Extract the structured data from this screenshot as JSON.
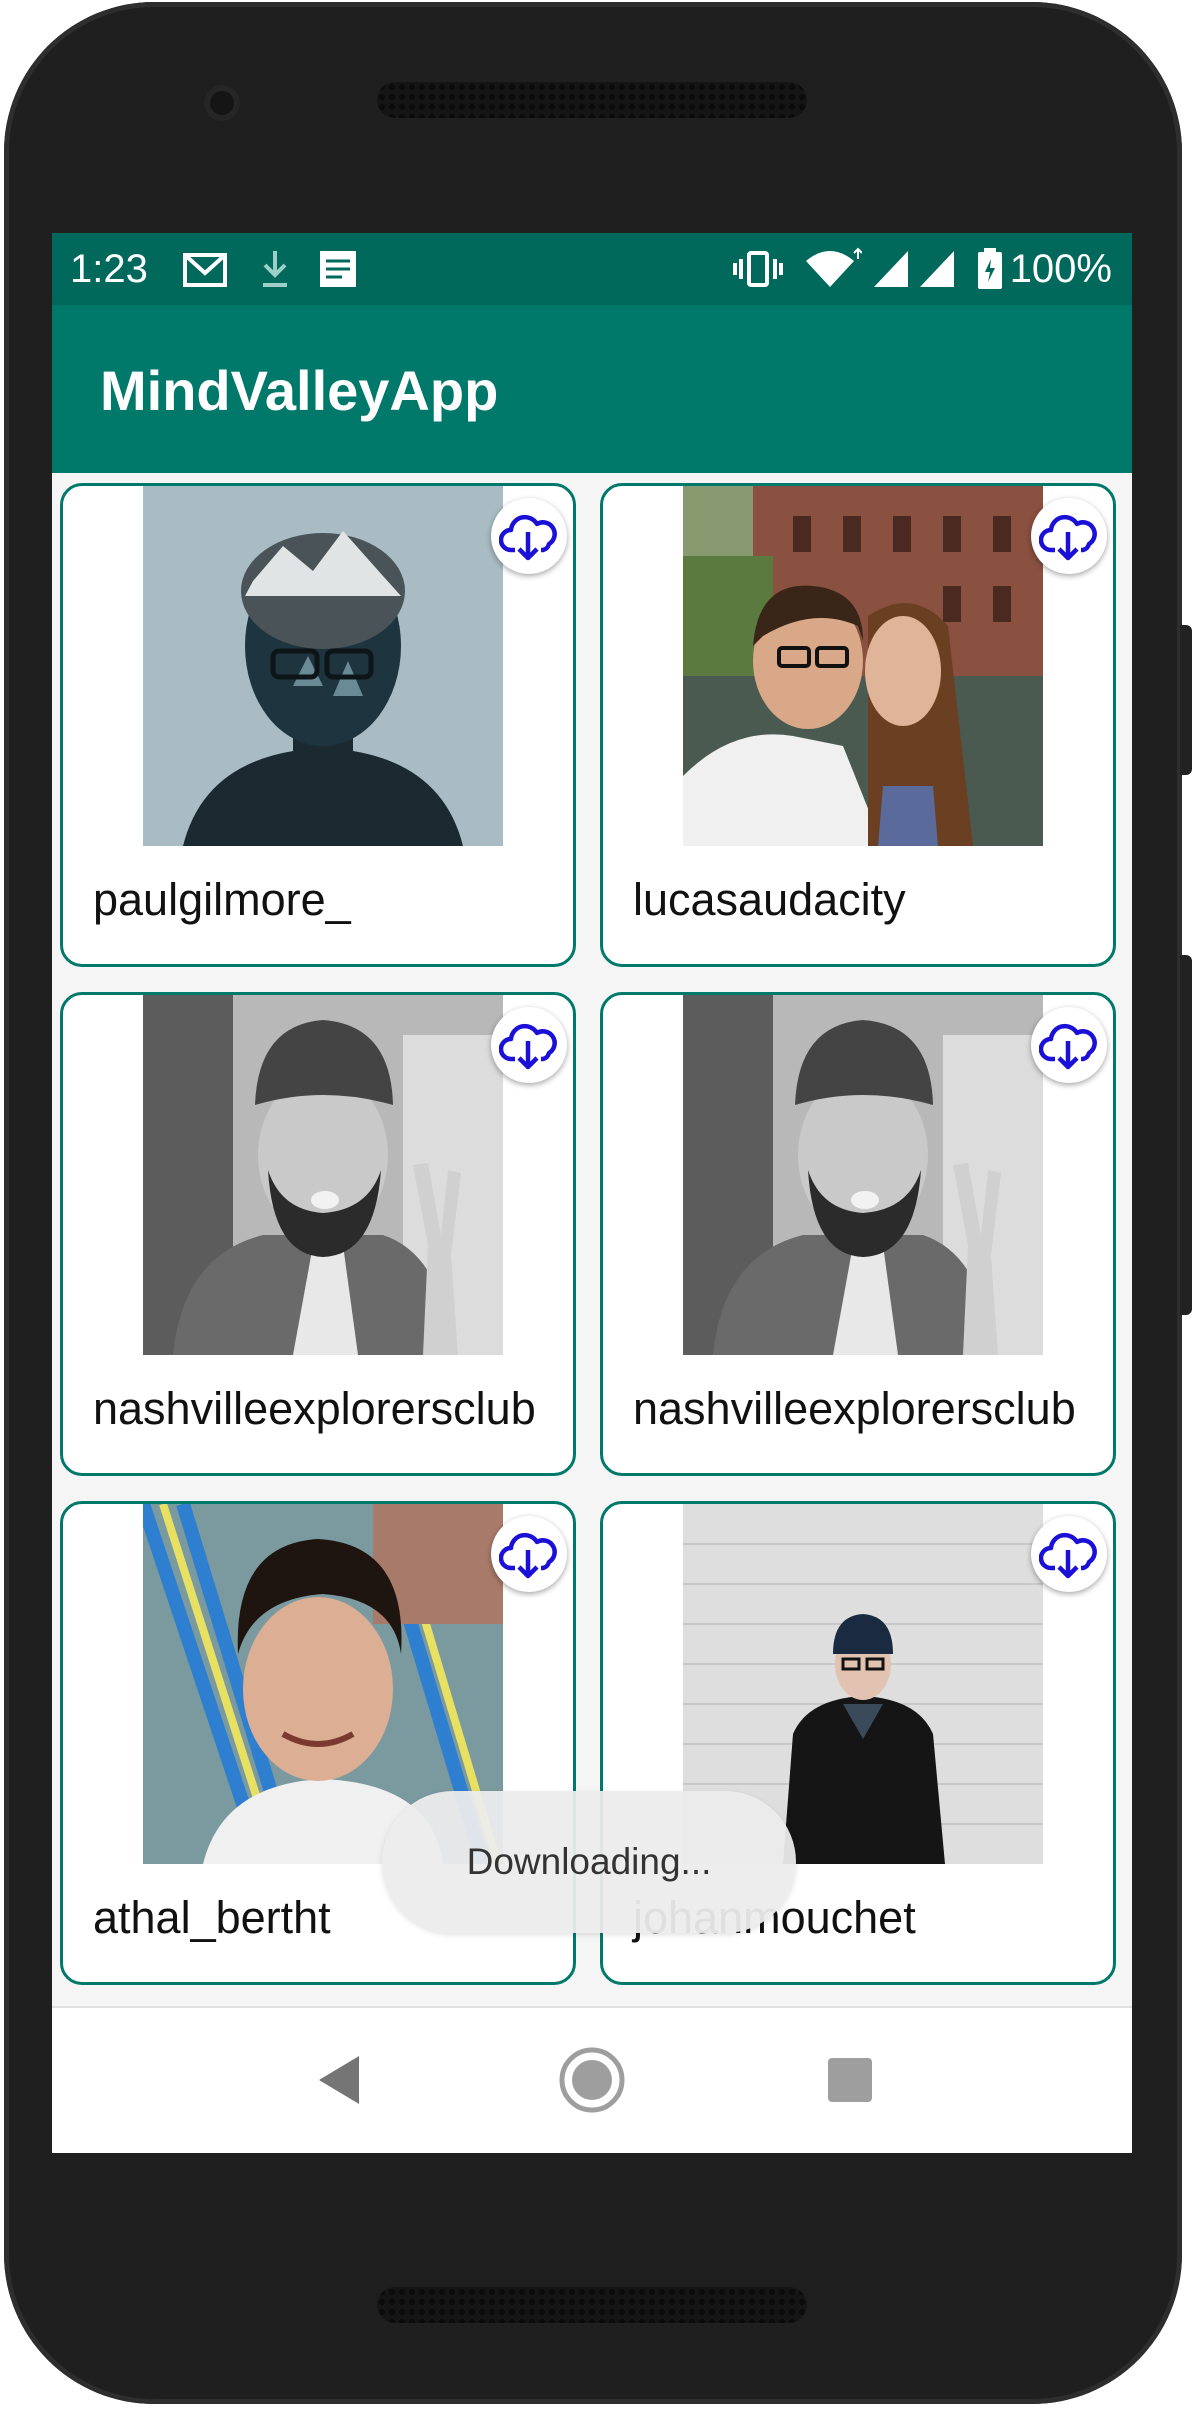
{
  "status_bar": {
    "time": "1:23",
    "battery": "100%",
    "left_icons": [
      "gmail-icon",
      "download-icon",
      "screenshot-icon"
    ],
    "right_icons": [
      "vibrate-icon",
      "wifi-icon",
      "signal-icon",
      "signal-icon",
      "battery-icon"
    ]
  },
  "app_bar": {
    "title": "MindValleyApp",
    "color": "#00796b",
    "status_color": "#00695c"
  },
  "grid": {
    "items": [
      {
        "username": "paulgilmore_",
        "image": "portrait-double-exposure"
      },
      {
        "username": "lucasaudacity",
        "image": "couple-selfie-canal"
      },
      {
        "username": "nashvilleexplorersclub",
        "image": "bearded-man-peace-sign"
      },
      {
        "username": "nashvilleexplorersclub",
        "image": "bearded-man-peace-sign"
      },
      {
        "username": "athal_bertht",
        "image": "smiling-boy-hammock"
      },
      {
        "username": "johanmouchet",
        "image": "man-beanie-brick-wall"
      }
    ],
    "download_icon": "cloud-download-icon",
    "card_border_color": "#00796b",
    "download_icon_color": "#1a10d8"
  },
  "toast": {
    "text": "Downloading..."
  },
  "nav_bar": {
    "back": "back-icon",
    "home": "home-icon",
    "recents": "recents-icon"
  }
}
